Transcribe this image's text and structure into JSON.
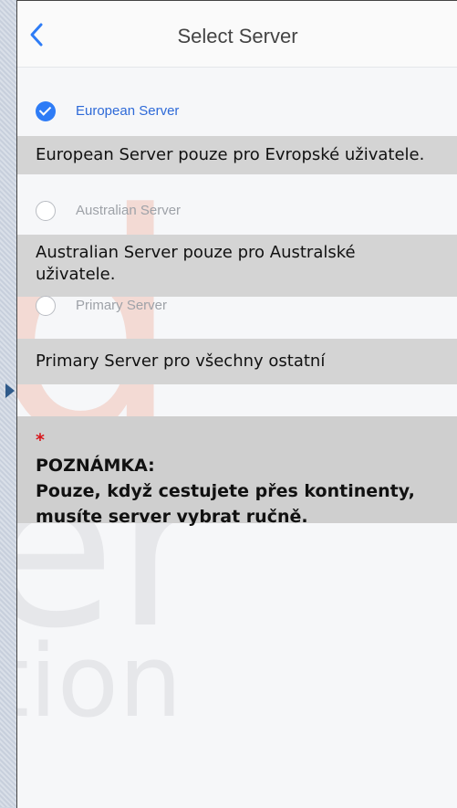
{
  "navbar": {
    "back_icon": "chevron-left-icon",
    "title": "Select Server"
  },
  "options": [
    {
      "label": "European Server",
      "selected": true
    },
    {
      "label": "Australian Server",
      "selected": false
    },
    {
      "label": "Primary Server",
      "selected": false
    }
  ],
  "callouts": {
    "european": "European Server pouze pro Evropské uživatele.",
    "australian_1": "Australian Server pouze pro Australské",
    "australian_2": "uživatele.",
    "primary": "Primary Server pro všechny ostatní"
  },
  "note": {
    "star": "*",
    "heading": "POZNÁMKA:",
    "line1": "Pouze, když cestujete přes kontinenty,",
    "line2": "musíte server vybrat ručně."
  },
  "watermark": {
    "d": "d",
    "er": "er",
    "tion": "tion"
  },
  "colors": {
    "accent": "#2e7cf6",
    "callout_bg": "#d4d4d4",
    "note_star": "#d8161b"
  }
}
